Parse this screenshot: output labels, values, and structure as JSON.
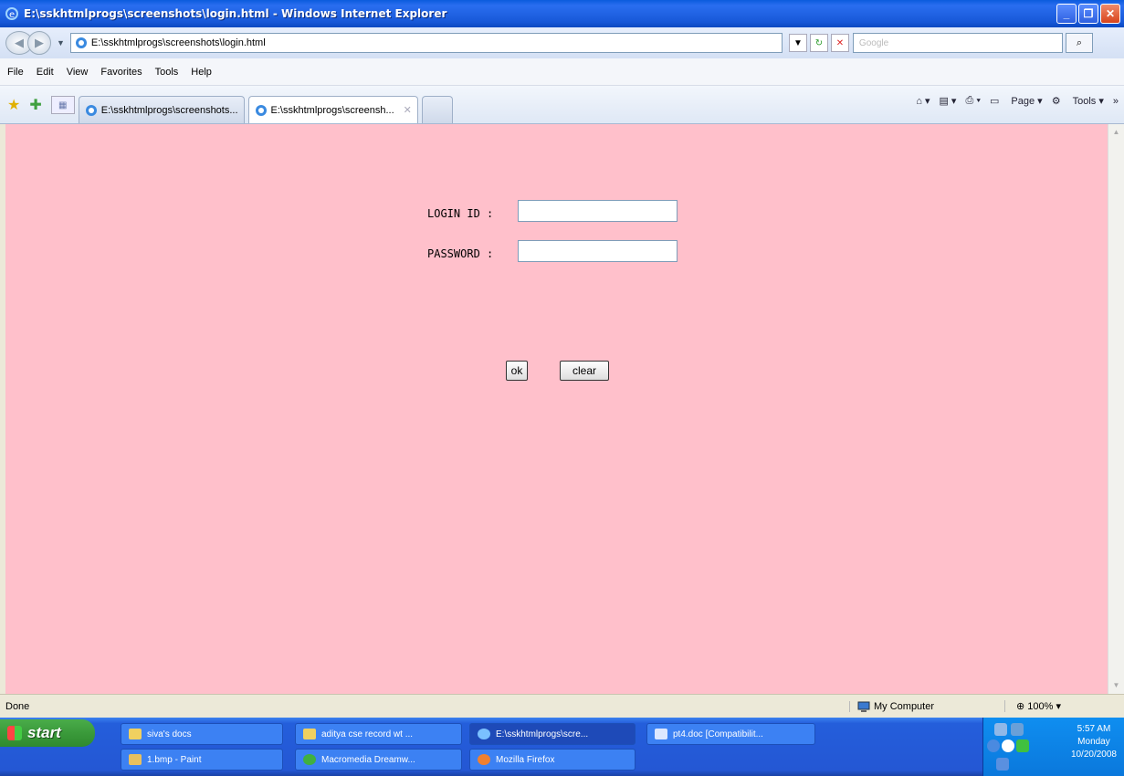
{
  "window": {
    "title": "E:\\sskhtmlprogs\\screenshots\\login.html - Windows Internet Explorer"
  },
  "address": {
    "url": "E:\\sskhtmlprogs\\screenshots\\login.html",
    "search_placeholder": "Google"
  },
  "menu": [
    "File",
    "Edit",
    "View",
    "Favorites",
    "Tools",
    "Help"
  ],
  "tabs": [
    {
      "label": "E:\\sskhtmlprogs\\screenshots..."
    },
    {
      "label": "E:\\sskhtmlprogs\\screensh..."
    }
  ],
  "commands": {
    "page": "Page",
    "tools": "Tools"
  },
  "form": {
    "login_label": "LOGIN ID :",
    "password_label": "PASSWORD :",
    "ok_label": "ok",
    "clear_label": "clear"
  },
  "status": {
    "text": "Done",
    "zone": "My Computer",
    "zoom": "100%"
  },
  "taskbar": {
    "start": "start",
    "tasks": [
      "siva's docs",
      "aditya cse record wt ...",
      "E:\\sskhtmlprogs\\scre...",
      "pt4.doc [Compatibilit...",
      "1.bmp - Paint",
      "Macromedia Dreamw...",
      "Mozilla Firefox"
    ],
    "time": "5:57 AM",
    "day": "Monday",
    "date": "10/20/2008"
  },
  "colors": {
    "page_background": "#ffc0cb",
    "titlebar": "#1758d8",
    "taskbar": "#245edb"
  }
}
